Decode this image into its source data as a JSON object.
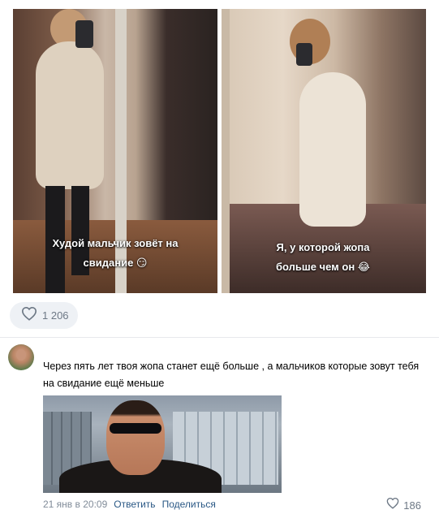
{
  "post": {
    "photo_left_caption_line1": "Худой мальчик зовёт на",
    "photo_left_caption_line2": "свидание 😏",
    "photo_right_caption_line1": "Я, у которой жопа",
    "photo_right_caption_line2": "больше чем он 😂",
    "like_count": "1 206",
    "like_icon": "heart-icon"
  },
  "comment": {
    "text": "Через пять лет твоя жопа станет ещё больше , а мальчиков которые зовут тебя на свидание ещё меньше",
    "timestamp": "21 янв в 20:09",
    "reply_label": "Ответить",
    "share_label": "Поделиться",
    "like_count": "186",
    "like_icon": "heart-icon"
  },
  "colors": {
    "link": "#2a5885",
    "meta": "#818c99",
    "pill_bg": "#eef1f5"
  }
}
